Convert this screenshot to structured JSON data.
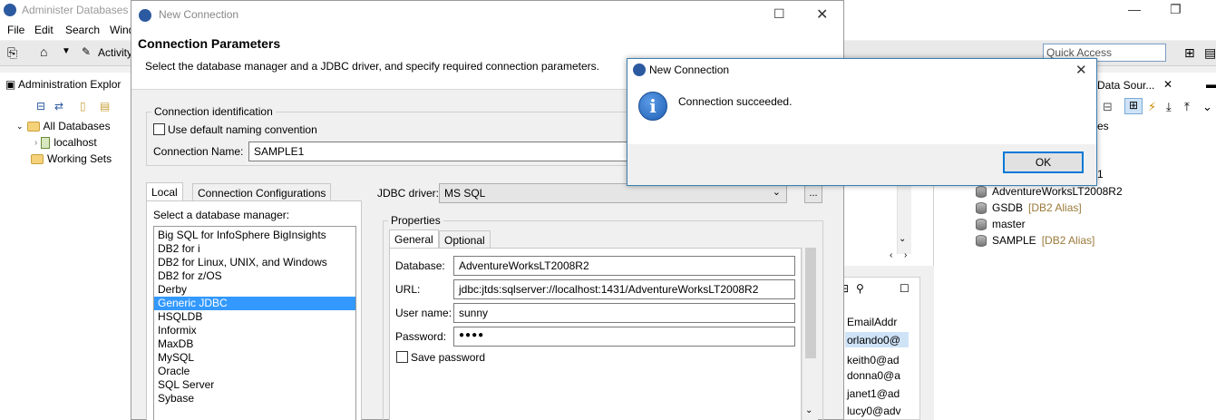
{
  "main_window": {
    "title": "Administer Databases",
    "menu": [
      "File",
      "Edit",
      "Search",
      "Wind"
    ],
    "toolbar_activity": "Activity",
    "quick_access_placeholder": "Quick Access"
  },
  "explorer": {
    "tab_label": "Administration Explor",
    "tree": {
      "all_databases": "All Databases",
      "localhost": "localhost",
      "working_sets": "Working Sets"
    }
  },
  "data_source_view": {
    "tab_label": "Data Sour...",
    "partial_label": "es",
    "partial_number": "1",
    "databases": [
      {
        "name": "AdventureWorksLT2008R2",
        "alias": ""
      },
      {
        "name": "GSDB",
        "alias": "[DB2 Alias]"
      },
      {
        "name": "master",
        "alias": ""
      },
      {
        "name": "SAMPLE",
        "alias": "[DB2 Alias]"
      }
    ]
  },
  "results_view": {
    "header": "EmailAddr",
    "rows": [
      "orlando0@",
      "keith0@ad",
      "donna0@a",
      "janet1@ad",
      "lucy0@adv"
    ]
  },
  "new_connection": {
    "title": "New Connection",
    "heading": "Connection Parameters",
    "description": "Select the database manager and a JDBC driver, and specify required connection parameters.",
    "identification_group": "Connection identification",
    "default_naming_label": "Use default naming convention",
    "connection_name_label": "Connection Name:",
    "connection_name_value": "SAMPLE1",
    "tabs": [
      "Local",
      "Connection Configurations"
    ],
    "select_manager_label": "Select a database manager:",
    "managers": [
      "Big SQL for InfoSphere BigInsights",
      "DB2 for i",
      "DB2 for Linux, UNIX, and Windows",
      "DB2 for z/OS",
      "Derby",
      "Generic JDBC",
      "HSQLDB",
      "Informix",
      "MaxDB",
      "MySQL",
      "Oracle",
      "SQL Server",
      "Sybase"
    ],
    "selected_manager": "Generic JDBC",
    "jdbc_driver_label": "JDBC driver:",
    "jdbc_driver_value": "MS SQL",
    "browse_label": "...",
    "properties_group": "Properties",
    "prop_tabs": [
      "General",
      "Optional"
    ],
    "fields": {
      "database_label": "Database:",
      "database_value": "AdventureWorksLT2008R2",
      "url_label": "URL:",
      "url_value": "jdbc:jtds:sqlserver://localhost:1431/AdventureWorksLT2008R2",
      "user_label": "User name:",
      "user_value": "sunny",
      "password_label": "Password:",
      "password_value": "●●●●"
    },
    "save_password_label": "Save password"
  },
  "success_dialog": {
    "title": "New Connection",
    "message": "Connection succeeded.",
    "ok_label": "OK"
  },
  "colors": {
    "selection": "#3399ff",
    "info_icon": "#1f5fb5",
    "ok_border": "#0078d7"
  }
}
